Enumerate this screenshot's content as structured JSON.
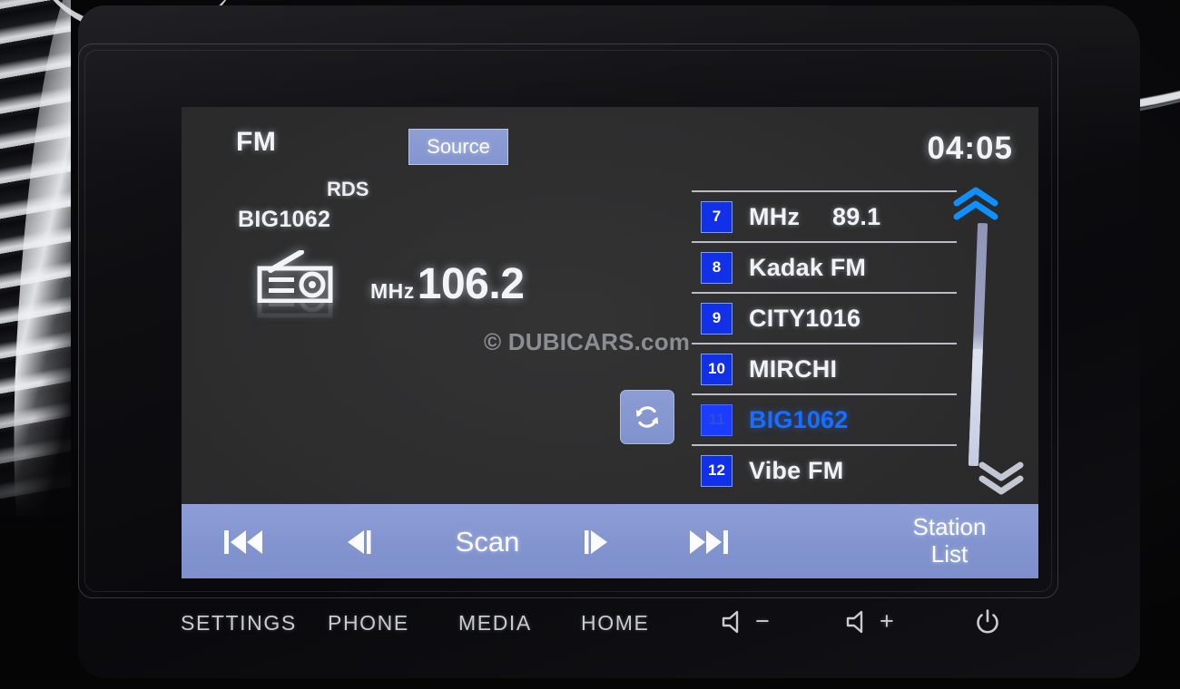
{
  "screen": {
    "band": "FM",
    "source_button": "Source",
    "clock": "04:05",
    "rds": "RDS",
    "current_station_name": "BIG1062",
    "frequency_unit": "MHz",
    "frequency_value": "106.2",
    "radio_icon": "radio-icon",
    "refresh_icon": "refresh-icon",
    "watermark": "© DUBICARS.com"
  },
  "station_list": {
    "scroll_up_icon": "chevron-double-up-icon",
    "scroll_down_icon": "chevron-double-down-icon",
    "items": [
      {
        "preset": "7",
        "label": "MHz",
        "value": "89.1",
        "selected": false
      },
      {
        "preset": "8",
        "label": "Kadak FM",
        "value": "",
        "selected": false
      },
      {
        "preset": "9",
        "label": "CITY1016",
        "value": "",
        "selected": false
      },
      {
        "preset": "10",
        "label": "MIRCHI",
        "value": "",
        "selected": false
      },
      {
        "preset": "11",
        "label": "BIG1062",
        "value": "",
        "selected": true
      },
      {
        "preset": "12",
        "label": "Vibe FM",
        "value": "",
        "selected": false
      }
    ]
  },
  "control_bar": {
    "prev_track_icon": "previous-track-icon",
    "step_back_icon": "step-backward-icon",
    "scan_label": "Scan",
    "step_forward_icon": "step-forward-icon",
    "next_track_icon": "next-track-icon",
    "station_list_line1": "Station",
    "station_list_line2": "List"
  },
  "hardware_buttons": {
    "settings": "SETTINGS",
    "phone": "PHONE",
    "media": "MEDIA",
    "home": "HOME",
    "volume_down_icon": "volume-down-icon",
    "volume_down_sign": "−",
    "volume_up_icon": "volume-up-icon",
    "volume_up_sign": "+",
    "power_icon": "power-icon"
  },
  "colors": {
    "accent_blue": "#1b3dff",
    "bar_periwinkle": "#8294cf",
    "screen_background": "#2b2b2c",
    "text_white": "#f0f2f5",
    "selected_text": "#1a6dff"
  }
}
